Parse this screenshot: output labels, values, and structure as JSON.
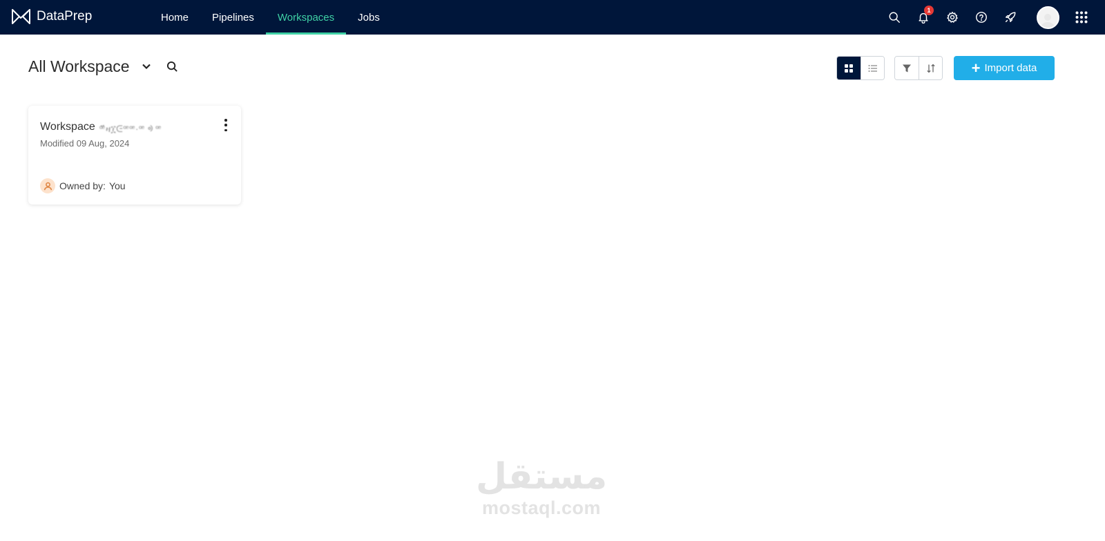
{
  "app": {
    "brand": "DataPrep",
    "nav": [
      {
        "label": "Home",
        "active": false
      },
      {
        "label": "Pipelines",
        "active": false
      },
      {
        "label": "Workspaces",
        "active": true
      },
      {
        "label": "Jobs",
        "active": false
      }
    ],
    "notifications_count": "1",
    "icons": [
      "search-icon",
      "bell-icon",
      "gear-icon",
      "help-icon",
      "rocket-icon",
      "avatar",
      "apps-grid-icon"
    ]
  },
  "header": {
    "title": "All Workspace"
  },
  "toolbar": {
    "view_mode": "grid",
    "import_label": "Import data"
  },
  "workspaces": [
    {
      "name": "Workspace",
      "name_suffix_obscured": "ꟹ፟ዛ፲ᕮꟹꟹ·ꟹ ᢀ ꟹ",
      "modified": "Modified 09 Aug, 2024",
      "owner_label": "Owned by:",
      "owner_value": "You"
    }
  ],
  "watermark": {
    "logo": "مستقل",
    "url": "mostaql.com"
  },
  "colors": {
    "topbar": "#00163a",
    "nav_active": "#3fd1a5",
    "primary_button": "#21aee8",
    "badge": "#e53935"
  }
}
